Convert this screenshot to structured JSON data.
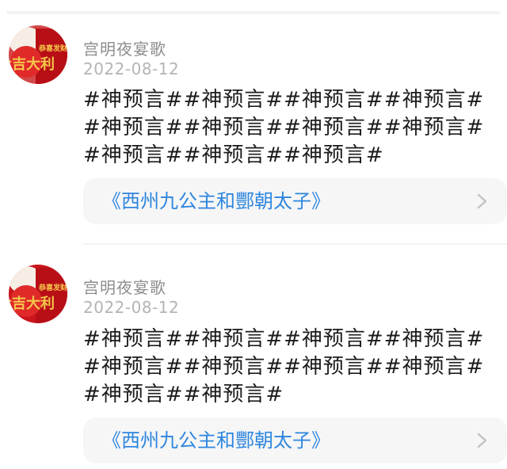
{
  "posts": [
    {
      "username": "宫明夜宴歌",
      "date": "2022-08-12",
      "content": "#神预言##神预言##神预言##神预言##神预言##神预言##神预言##神预言##神预言##神预言##神预言#",
      "book_title": "《西州九公主和酆朝太子》",
      "avatar_text_top": "恭喜发财",
      "avatar_text_main": "大吉大利"
    },
    {
      "username": "宫明夜宴歌",
      "date": "2022-08-12",
      "content": "#神预言##神预言##神预言##神预言##神预言##神预言##神预言##神预言##神预言##神预言#",
      "book_title": "《西州九公主和酆朝太子》",
      "avatar_text_top": "恭喜发财",
      "avatar_text_main": "大吉大利"
    }
  ],
  "colors": {
    "username": "#8d8d8d",
    "date": "#b4b4b4",
    "content": "#1c1c1c",
    "book_link": "#2e86de",
    "card_bg": "#f6f6f7",
    "avatar_red": "#d41c1c",
    "avatar_gold": "#f6c84a"
  },
  "icons": {
    "avatar": "red-lucky-avatar",
    "chevron": "chevron-right-icon"
  }
}
